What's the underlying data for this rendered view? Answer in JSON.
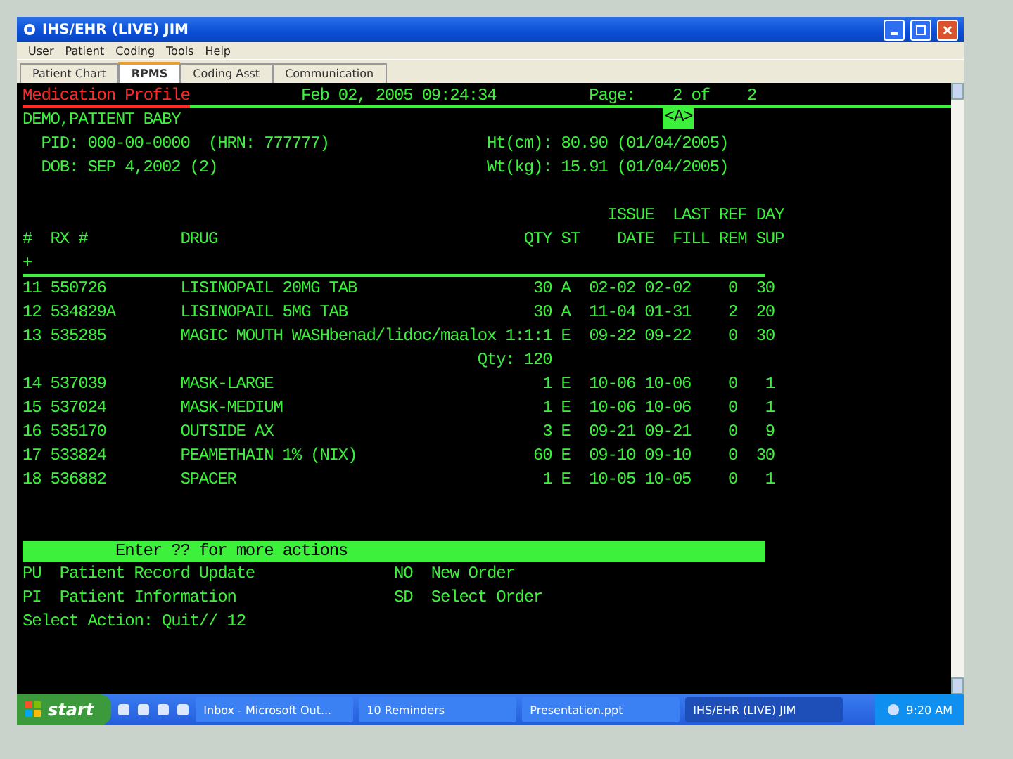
{
  "window": {
    "title": "IHS/EHR (LIVE) JIM"
  },
  "menu": [
    "User",
    "Patient",
    "Coding",
    "Tools",
    "Help"
  ],
  "tabs": [
    {
      "label": "Patient Chart",
      "selected": false
    },
    {
      "label": "RPMS",
      "selected": true
    },
    {
      "label": "Coding Asst",
      "selected": false
    },
    {
      "label": "Communication",
      "selected": false
    }
  ],
  "terminal": {
    "screen_title": "Medication Profile",
    "timestamp": "Feb 02, 2005 09:24:34",
    "page_label": "Page:",
    "page_of": "2 of",
    "page_total": "2",
    "patient": "DEMO,PATIENT BABY",
    "flag": "<A>",
    "info": [
      {
        "left": "PID: 000-00-0000  (HRN: 777777)",
        "right": "Ht(cm): 80.90 (01/04/2005)"
      },
      {
        "left": "DOB: SEP 4,2002 (2)",
        "right": "Wt(kg): 15.91 (01/04/2005)"
      }
    ],
    "columns": [
      {
        "label": "#"
      },
      {
        "label": "RX #"
      },
      {
        "label": "DRUG"
      },
      {
        "label": "QTY"
      },
      {
        "label": "ST"
      },
      {
        "top": "ISSUE",
        "label": "DATE"
      },
      {
        "top": "LAST",
        "label": "FILL"
      },
      {
        "top": "REF",
        "label": "REM"
      },
      {
        "top": "DAY",
        "label": "SUP"
      }
    ],
    "more_marker": "+",
    "rows": [
      {
        "cells": [
          "11",
          "550726",
          "LISINOPAIL 20MG TAB",
          "30",
          "A",
          "02-02",
          "02-02",
          "0",
          "30"
        ]
      },
      {
        "cells": [
          "12",
          "534829A",
          "LISINOPAIL 5MG TAB",
          "30",
          "A",
          "11-04",
          "01-31",
          "2",
          "20"
        ]
      },
      {
        "cells": [
          "13",
          "535285",
          "MAGIC MOUTH WASHbenad/lidoc/maalox 1:1:1",
          "",
          "E",
          "09-22",
          "09-22",
          "0",
          "30"
        ],
        "note": "Qty: 120"
      },
      {
        "cells": [
          "14",
          "537039",
          "MASK-LARGE",
          "1",
          "E",
          "10-06",
          "10-06",
          "0",
          "1"
        ]
      },
      {
        "cells": [
          "15",
          "537024",
          "MASK-MEDIUM",
          "1",
          "E",
          "10-06",
          "10-06",
          "0",
          "1"
        ]
      },
      {
        "cells": [
          "16",
          "535170",
          "OUTSIDE AX",
          "3",
          "E",
          "09-21",
          "09-21",
          "0",
          "9"
        ]
      },
      {
        "cells": [
          "17",
          "533824",
          "PEAMETHAIN 1% (NIX)",
          "60",
          "E",
          "09-10",
          "09-10",
          "0",
          "30"
        ]
      },
      {
        "cells": [
          "18",
          "536882",
          "SPACER",
          "1",
          "E",
          "10-05",
          "10-05",
          "0",
          "1"
        ]
      }
    ],
    "hint": "Enter ?? for more actions",
    "actions": [
      {
        "code": "PU",
        "label": "Patient Record Update"
      },
      {
        "code": "NO",
        "label": "New Order"
      },
      {
        "code": "PI",
        "label": "Patient Information"
      },
      {
        "code": "SD",
        "label": "Select Order"
      }
    ],
    "prompt": "Select Action: Quit// 12"
  },
  "taskbar": {
    "start": "start",
    "tasks": [
      {
        "label": "Inbox - Microsoft Out...",
        "selected": false
      },
      {
        "label": "10 Reminders",
        "selected": false
      },
      {
        "label": "Presentation.ppt",
        "selected": false
      },
      {
        "label": "IHS/EHR (LIVE) JIM",
        "selected": true
      }
    ],
    "clock": "9:20 AM"
  }
}
